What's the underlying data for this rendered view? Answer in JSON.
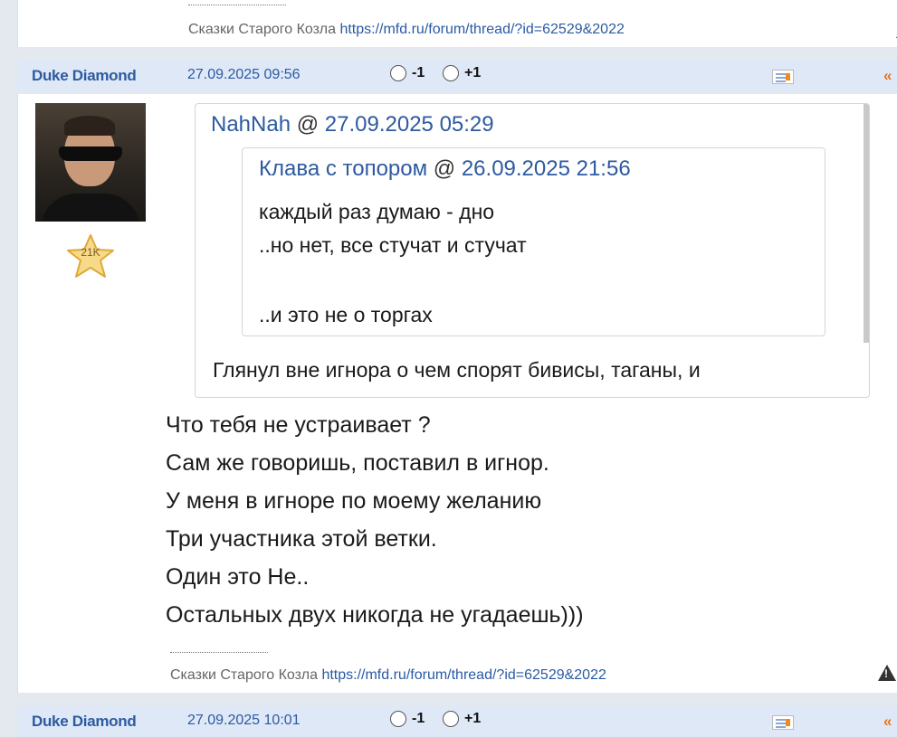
{
  "colors": {
    "accent": "#2d5aa0",
    "header_bg": "#dfe8f7",
    "nav_arrow": "#e8731a"
  },
  "prev_post": {
    "signature_sep": "--------------------",
    "signature_text": "Сказки Старого Козла",
    "signature_link": "https://mfd.ru/forum/thread/?id=62529&2022",
    "warn_icon": "warning-icon"
  },
  "post": {
    "author": "Duke Diamond",
    "date": "27.09.2025 09:56",
    "vote_minus": "-1",
    "vote_plus": "+1",
    "card_icon": "profile-card-icon",
    "nav_icon": "double-chevron-left-icon",
    "nav_label": "«",
    "avatar_icon": "avatar-photo",
    "rating_badge": "21K",
    "quote": {
      "author": "NahNah",
      "at": "@",
      "date": "27.09.2025 05:29",
      "nested": {
        "author": "Клава с топором",
        "at": "@",
        "date": "26.09.2025 21:56",
        "lines": [
          "каждый раз думаю - дно",
          "..но нет, все стучат и стучат",
          "",
          "..и это не о торгах"
        ]
      },
      "text": "Глянул вне игнора о чем спорят бивисы, таганы, и"
    },
    "lines": [
      "Что тебя не устраивает ?",
      "Сам же говоришь, поставил в игнор.",
      "У меня в игноре по моему желанию",
      "Три участника этой ветки.",
      "Один это Не..",
      "Остальных двух никогда не угадаешь)))"
    ],
    "signature_sep": "--------------------",
    "signature_text": "Сказки Старого Козла",
    "signature_link": "https://mfd.ru/forum/thread/?id=62529&2022"
  },
  "next_post": {
    "author": "Duke Diamond",
    "date": "27.09.2025 10:01",
    "vote_minus": "-1",
    "vote_plus": "+1",
    "nav_label": "«"
  }
}
